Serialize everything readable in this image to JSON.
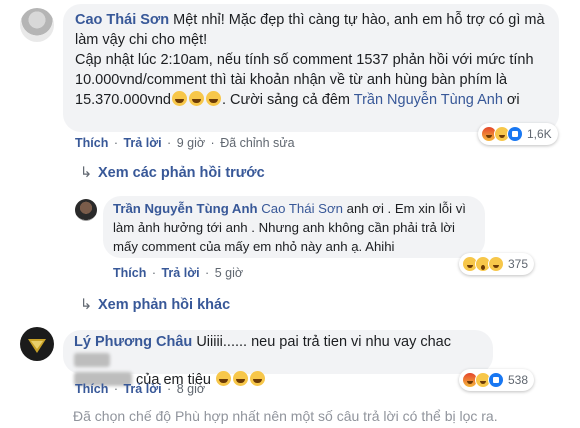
{
  "comments": {
    "first": {
      "author": "Cao Thái Sơn",
      "text_1": "Mệt nhỉ! Mặc đẹp thì càng tự hào, anh em hỗ trợ có gì mà làm vậy chi cho mệt!",
      "text_2": "Cập nhật lúc 2:10am, nếu tính số comment 1537 phản hồi với mức tính 10.000vnd/comment thì tài khoản nhận về từ anh hùng bàn phím là 15.370.000vnd",
      "text_3": ". Cười sảng cả đêm",
      "mention": "Trần Nguyễn Tùng Anh",
      "text_4": "ơi",
      "action_like": "Thích",
      "action_reply": "Trả lời",
      "time": "9 giờ",
      "edited": "Đã chỉnh sửa",
      "reaction_count": "1,6K"
    },
    "view_previous_replies": "Xem các phản hồi trước",
    "reply": {
      "author": "Trần Nguyễn Tùng Anh",
      "mention": "Cao Thái Sơn",
      "text": "anh ơi . Em xin lỗi vì làm ảnh hưởng tới anh . Nhưng anh không cần phải trả lời mấy comment của mấy em nhỏ này anh ạ. Ahihi",
      "action_like": "Thích",
      "action_reply": "Trả lời",
      "time": "5 giờ",
      "reaction_count": "375"
    },
    "view_more_replies": "Xem phản hồi khác",
    "third": {
      "author": "Lý Phương Châu",
      "text_1": "Uiiiii...... neu pai trả tien vi nhu vay chac",
      "text_2": "của em tiêu",
      "action_like": "Thích",
      "action_reply": "Trả lời",
      "time": "8 giờ",
      "reaction_count": "538"
    },
    "filter_note": "Đã chọn chế độ Phù hợp nhất nên một số câu trả lời có thể bị lọc ra."
  },
  "colors": {
    "link": "#385898",
    "bubble": "#f2f3f5",
    "meta": "#606770"
  },
  "icons": [
    "avatar-photo",
    "avatar-logo",
    "reply-arrow-icon",
    "angry-reaction-icon",
    "haha-reaction-icon",
    "like-reaction-icon",
    "wow-reaction-icon",
    "cry-reaction-icon"
  ]
}
